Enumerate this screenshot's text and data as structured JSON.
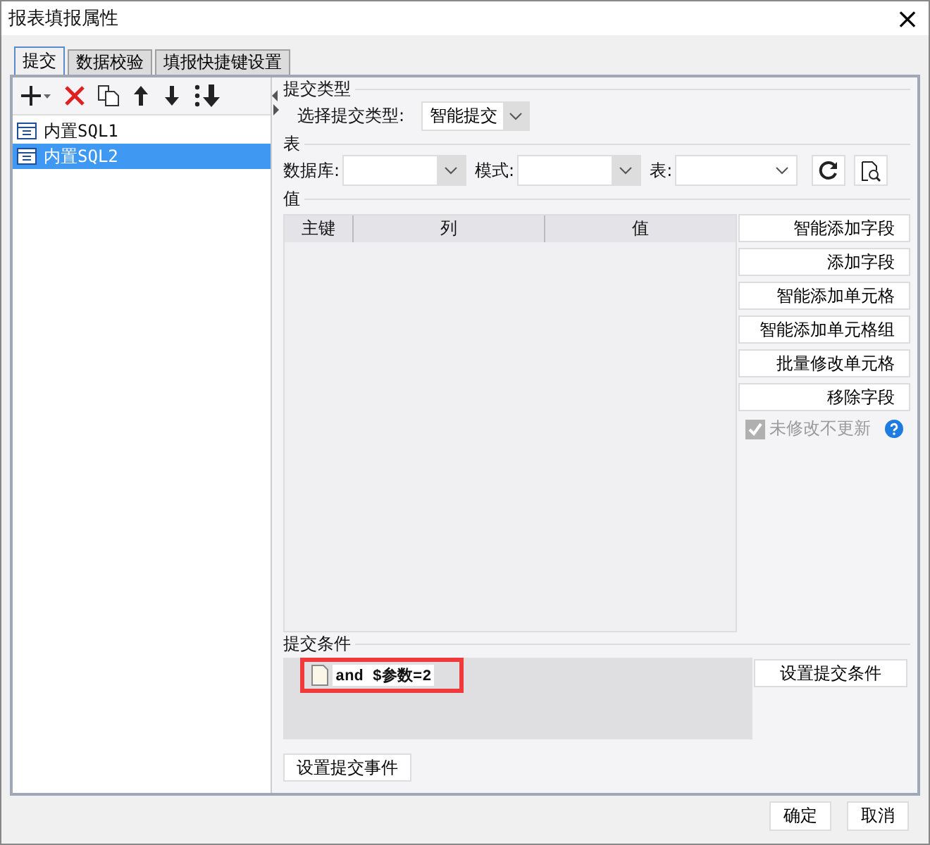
{
  "window": {
    "title": "报表填报属性",
    "close": "×"
  },
  "tabs": [
    {
      "label": "提交",
      "selected": true
    },
    {
      "label": "数据校验",
      "selected": false
    },
    {
      "label": "填报快捷键设置",
      "selected": false
    }
  ],
  "sidebar": {
    "items": [
      {
        "label": "内置SQL1",
        "selected": false
      },
      {
        "label": "内置SQL2",
        "selected": true
      }
    ]
  },
  "submit_type": {
    "heading": "提交类型",
    "label": "选择提交类型:",
    "value": "智能提交"
  },
  "table_section": {
    "heading": "表",
    "fields": [
      {
        "label": "数据库:"
      },
      {
        "label": "模式:"
      },
      {
        "label": "表:"
      }
    ]
  },
  "values": {
    "heading": "值",
    "columns": [
      "主键",
      "列",
      "值"
    ],
    "buttons": [
      "智能添加字段",
      "添加字段",
      "智能添加单元格",
      "智能添加单元格组",
      "批量修改单元格",
      "移除字段"
    ],
    "option": {
      "label": "未修改不更新",
      "checked": true,
      "disabled": true
    }
  },
  "condition": {
    "heading": "提交条件",
    "expression": "and $参数=2",
    "button": "设置提交条件"
  },
  "event_button": "设置提交事件",
  "footer_buttons": [
    "确定",
    "取消"
  ]
}
